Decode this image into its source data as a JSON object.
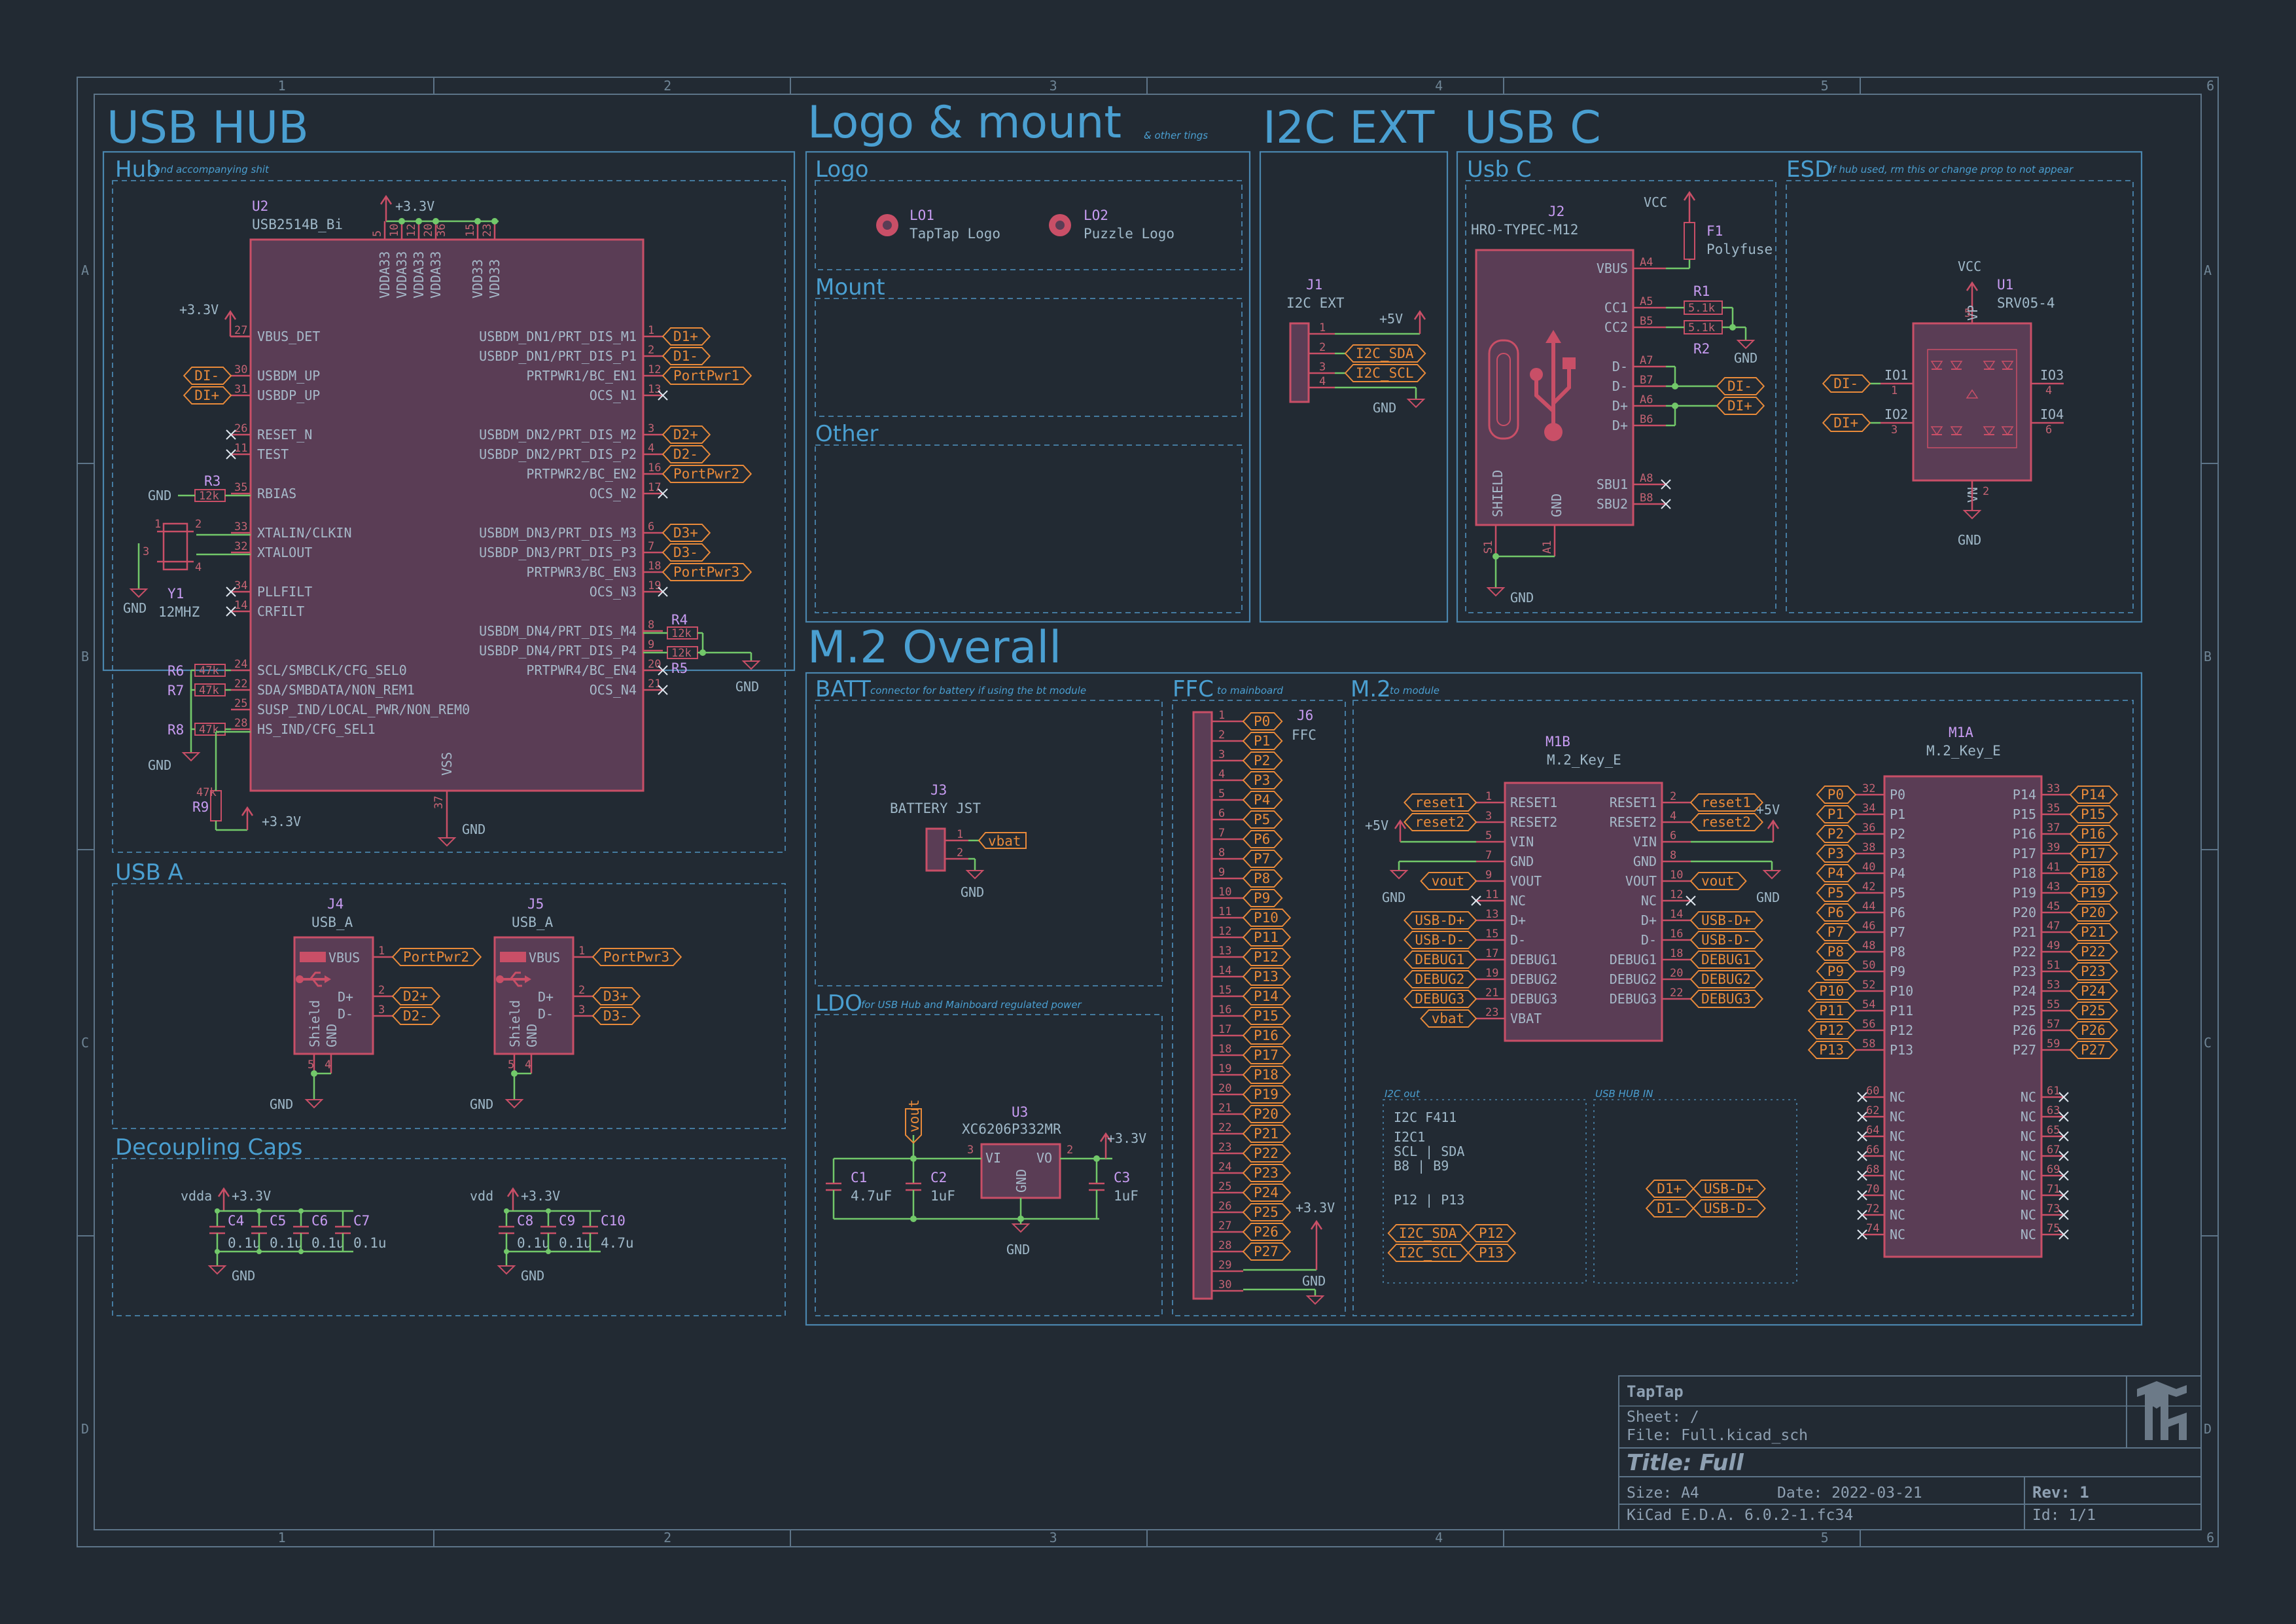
{
  "sheet_titles": {
    "usb_hub": "USB HUB",
    "logo_mount": "Logo & mount",
    "logo_mount_note": "& other tings",
    "i2c_ext": "I2C EXT",
    "usb_c": "USB C",
    "m2_overall": "M.2 Overall"
  },
  "sections": {
    "hub": {
      "title": "Hub",
      "note": "and accompanying shit"
    },
    "usb_a": {
      "title": "USB A"
    },
    "decoupling": {
      "title": "Decoupling Caps"
    },
    "logo": {
      "title": "Logo"
    },
    "mount": {
      "title": "Mount"
    },
    "other": {
      "title": "Other"
    },
    "usbc": {
      "title": "Usb C"
    },
    "esd": {
      "title": "ESD",
      "note": "If hub used, rm this or change prop to not appear"
    },
    "batt": {
      "title": "BATT",
      "note": "connector for battery if using the bt module"
    },
    "ldo": {
      "title": "LDO",
      "note": "for USB Hub and Mainboard regulated power"
    },
    "ffc": {
      "title": "FFC",
      "note": "to mainboard"
    },
    "m2": {
      "title": "M.2",
      "note": "to module"
    },
    "i2c_out": {
      "title": "I2C out"
    },
    "usb_hub_in": {
      "title": "USB HUB IN"
    }
  },
  "u2": {
    "ref": "U2",
    "value": "USB2514B_Bi",
    "top_pins": [
      "VDDA33",
      "VDDA33",
      "VDDA33",
      "VDDA33",
      "VDD33",
      "VDD33"
    ],
    "top_nums": [
      "5",
      "10",
      "12",
      "20",
      "36",
      "15",
      "23"
    ],
    "left": [
      {
        "n": "27",
        "t": "VBUS_DET"
      },
      {
        "n": "30",
        "t": "USBDM_UP"
      },
      {
        "n": "31",
        "t": "USBDP_UP"
      },
      {
        "n": "26",
        "t": "RESET_N"
      },
      {
        "n": "11",
        "t": "TEST"
      },
      {
        "n": "35",
        "t": "RBIAS"
      },
      {
        "n": "33",
        "t": "XTALIN/CLKIN"
      },
      {
        "n": "32",
        "t": "XTALOUT"
      },
      {
        "n": "34",
        "t": "PLLFILT"
      },
      {
        "n": "14",
        "t": "CRFILT"
      },
      {
        "n": "24",
        "t": "SCL/SMBCLK/CFG_SEL0"
      },
      {
        "n": "22",
        "t": "SDA/SMBDATA/NON_REM1"
      },
      {
        "n": "25",
        "t": "SUSP_IND/LOCAL_PWR/NON_REM0"
      },
      {
        "n": "28",
        "t": "HS_IND/CFG_SEL1"
      }
    ],
    "right": [
      {
        "n": "1",
        "t": "USBDM_DN1/PRT_DIS_M1"
      },
      {
        "n": "2",
        "t": "USBDP_DN1/PRT_DIS_P1"
      },
      {
        "n": "12",
        "t": "PRTPWR1/BC_EN1"
      },
      {
        "n": "13",
        "t": "OCS_N1"
      },
      {
        "n": "3",
        "t": "USBDM_DN2/PRT_DIS_M2"
      },
      {
        "n": "4",
        "t": "USBDP_DN2/PRT_DIS_P2"
      },
      {
        "n": "16",
        "t": "PRTPWR2/BC_EN2"
      },
      {
        "n": "17",
        "t": "OCS_N2"
      },
      {
        "n": "6",
        "t": "USBDM_DN3/PRT_DIS_M3"
      },
      {
        "n": "7",
        "t": "USBDP_DN3/PRT_DIS_P3"
      },
      {
        "n": "18",
        "t": "PRTPWR3/BC_EN3"
      },
      {
        "n": "19",
        "t": "OCS_N3"
      },
      {
        "n": "8",
        "t": "USBDM_DN4/PRT_DIS_M4"
      },
      {
        "n": "9",
        "t": "USBDP_DN4/PRT_DIS_P4"
      },
      {
        "n": "20",
        "t": "PRTPWR4/BC_EN4"
      },
      {
        "n": "21",
        "t": "OCS_N4"
      }
    ],
    "vss": "VSS",
    "vss_num": "37",
    "right_labels": [
      "D1+",
      "D1-",
      "PortPwr1",
      "D2+",
      "D2-",
      "PortPwr2",
      "D3+",
      "D3-",
      "PortPwr3"
    ],
    "left_labels": [
      "DI-",
      "DI+"
    ]
  },
  "hub_parts": {
    "r3": "R3",
    "r3v": "12k",
    "y1": "Y1",
    "y1v": "12MHZ",
    "r4": "R4",
    "r5": "R5",
    "r45v": "12k",
    "r6": "R6",
    "r7": "R7",
    "r8": "R8",
    "r9": "R9",
    "rv": "47k",
    "y1pins": [
      "1",
      "2",
      "3",
      "4"
    ]
  },
  "power": {
    "p33": "+3.3V",
    "gnd": "GND",
    "vcc": "VCC",
    "p5": "+5V",
    "vdda": "vdda",
    "vdd": "vdd"
  },
  "usb_a": [
    {
      "ref": "J4",
      "value": "USB_A",
      "pins": [
        "VBUS",
        "D+",
        "D-",
        "Shield",
        "GND"
      ],
      "labels": [
        "PortPwr2",
        "D2+",
        "D2-"
      ]
    },
    {
      "ref": "J5",
      "value": "USB_A",
      "pins": [
        "VBUS",
        "D+",
        "D-",
        "Shield",
        "GND"
      ],
      "labels": [
        "PortPwr3",
        "D3+",
        "D3-"
      ]
    }
  ],
  "caps_a": [
    {
      "ref": "C4",
      "v": "0.1u"
    },
    {
      "ref": "C5",
      "v": "0.1u"
    },
    {
      "ref": "C6",
      "v": "0.1u"
    },
    {
      "ref": "C7",
      "v": "0.1u"
    }
  ],
  "caps_b": [
    {
      "ref": "C8",
      "v": "0.1u"
    },
    {
      "ref": "C9",
      "v": "0.1u"
    },
    {
      "ref": "C10",
      "v": "4.7u"
    }
  ],
  "logos": [
    {
      "ref": "LO1",
      "v": "TapTap Logo"
    },
    {
      "ref": "LO2",
      "v": "Puzzle Logo"
    }
  ],
  "j1": {
    "ref": "J1",
    "value": "I2C EXT",
    "pins": [
      "1",
      "2",
      "3",
      "4"
    ],
    "labels": [
      "I2C_SDA",
      "I2C_SCL"
    ]
  },
  "j2": {
    "ref": "J2",
    "value": "HRO-TYPEC-M12",
    "pins": [
      "VBUS",
      "CC1",
      "CC2",
      "D-",
      "D-",
      "D+",
      "D+",
      "SBU1",
      "SBU2"
    ],
    "nums": [
      "A4",
      "A5",
      "B5",
      "A7",
      "B7",
      "A6",
      "B6",
      "A8",
      "B8"
    ],
    "bottom": [
      "SHIELD",
      "GND"
    ],
    "bottom_nums": [
      "S1",
      "A1"
    ],
    "labels": [
      "DI-",
      "DI+"
    ]
  },
  "f1": {
    "ref": "F1",
    "value": "Polyfuse"
  },
  "r1r2": {
    "r1": "R1",
    "r2": "R2",
    "v": "5.1k"
  },
  "u1": {
    "ref": "U1",
    "value": "SRV05-4",
    "pins": [
      "IO1",
      "IO2",
      "IO3",
      "IO4",
      "VP",
      "VN"
    ],
    "nums": [
      "1",
      "3",
      "4",
      "6",
      "5",
      "2"
    ],
    "labels": [
      "DI-",
      "DI+"
    ]
  },
  "j3": {
    "ref": "J3",
    "value": "BATTERY JST",
    "pins": [
      "1",
      "2"
    ],
    "label": "vbat"
  },
  "u3": {
    "ref": "U3",
    "value": "XC6206P332MR",
    "pins": [
      "VI",
      "VO",
      "GND"
    ],
    "nums": [
      "3",
      "2",
      "1"
    ],
    "label": "vout"
  },
  "ldo_caps": [
    {
      "ref": "C1",
      "v": "4.7uF"
    },
    {
      "ref": "C2",
      "v": "1uF"
    },
    {
      "ref": "C3",
      "v": "1uF"
    }
  ],
  "j6": {
    "ref": "J6",
    "value": "FFC",
    "labels": [
      "P0",
      "P1",
      "P2",
      "P3",
      "P4",
      "P5",
      "P6",
      "P7",
      "P8",
      "P9",
      "P10",
      "P11",
      "P12",
      "P13",
      "P14",
      "P15",
      "P16",
      "P17",
      "P18",
      "P19",
      "P20",
      "P21",
      "P22",
      "P23",
      "P24",
      "P25",
      "P26",
      "P27"
    ]
  },
  "m1b": {
    "ref": "M1B",
    "value": "M.2_Key_E",
    "left": [
      {
        "n": "1",
        "t": "RESET1",
        "l": "reset1"
      },
      {
        "n": "3",
        "t": "RESET2",
        "l": "reset2"
      },
      {
        "n": "5",
        "t": "VIN",
        "l": ""
      },
      {
        "n": "7",
        "t": "GND",
        "l": ""
      },
      {
        "n": "9",
        "t": "VOUT",
        "l": "vout"
      },
      {
        "n": "11",
        "t": "NC",
        "l": ""
      },
      {
        "n": "13",
        "t": "D+",
        "l": "USB-D+"
      },
      {
        "n": "15",
        "t": "D-",
        "l": "USB-D-"
      },
      {
        "n": "17",
        "t": "DEBUG1",
        "l": "DEBUG1"
      },
      {
        "n": "19",
        "t": "DEBUG2",
        "l": "DEBUG2"
      },
      {
        "n": "21",
        "t": "DEBUG3",
        "l": "DEBUG3"
      },
      {
        "n": "23",
        "t": "VBAT",
        "l": "vbat"
      }
    ],
    "right": [
      {
        "n": "2",
        "t": "RESET1",
        "l": "reset1"
      },
      {
        "n": "4",
        "t": "RESET2",
        "l": "reset2"
      },
      {
        "n": "6",
        "t": "VIN",
        "l": ""
      },
      {
        "n": "8",
        "t": "GND",
        "l": ""
      },
      {
        "n": "10",
        "t": "VOUT",
        "l": "vout"
      },
      {
        "n": "12",
        "t": "NC",
        "l": ""
      },
      {
        "n": "14",
        "t": "D+",
        "l": "USB-D+"
      },
      {
        "n": "16",
        "t": "D-",
        "l": "USB-D-"
      },
      {
        "n": "18",
        "t": "DEBUG1",
        "l": "DEBUG1"
      },
      {
        "n": "20",
        "t": "DEBUG2",
        "l": "DEBUG2"
      },
      {
        "n": "22",
        "t": "DEBUG3",
        "l": "DEBUG3"
      }
    ]
  },
  "m1a": {
    "ref": "M1A",
    "value": "M.2_Key_E",
    "left": [
      {
        "n": "32",
        "t": "P0"
      },
      {
        "n": "34",
        "t": "P1"
      },
      {
        "n": "36",
        "t": "P2"
      },
      {
        "n": "38",
        "t": "P3"
      },
      {
        "n": "40",
        "t": "P4"
      },
      {
        "n": "42",
        "t": "P5"
      },
      {
        "n": "44",
        "t": "P6"
      },
      {
        "n": "46",
        "t": "P7"
      },
      {
        "n": "48",
        "t": "P8"
      },
      {
        "n": "50",
        "t": "P9"
      },
      {
        "n": "52",
        "t": "P10"
      },
      {
        "n": "54",
        "t": "P11"
      },
      {
        "n": "56",
        "t": "P12"
      },
      {
        "n": "58",
        "t": "P13"
      }
    ],
    "right": [
      {
        "n": "33",
        "t": "P14"
      },
      {
        "n": "35",
        "t": "P15"
      },
      {
        "n": "37",
        "t": "P16"
      },
      {
        "n": "39",
        "t": "P17"
      },
      {
        "n": "41",
        "t": "P18"
      },
      {
        "n": "43",
        "t": "P19"
      },
      {
        "n": "45",
        "t": "P20"
      },
      {
        "n": "47",
        "t": "P21"
      },
      {
        "n": "49",
        "t": "P22"
      },
      {
        "n": "51",
        "t": "P23"
      },
      {
        "n": "53",
        "t": "P24"
      },
      {
        "n": "55",
        "t": "P25"
      },
      {
        "n": "57",
        "t": "P26"
      },
      {
        "n": "59",
        "t": "P27"
      }
    ],
    "nc_left": [
      "60",
      "62",
      "64",
      "66",
      "68",
      "70",
      "72",
      "74"
    ],
    "nc_right": [
      "61",
      "63",
      "65",
      "67",
      "69",
      "71",
      "73",
      "75"
    ],
    "nc": "NC"
  },
  "i2c_out": {
    "lines": [
      "I2C F411",
      "I2C1",
      "SCL | SDA",
      "B8  | B9",
      "P12 | P13"
    ],
    "labels": [
      "I2C_SDA",
      "I2C_SCL",
      "P12",
      "P13"
    ]
  },
  "usb_hub_in": {
    "labels": [
      "D1+",
      "D1-",
      "USB-D+",
      "USB-D-"
    ]
  },
  "title_block": {
    "company": "TapTap",
    "sheet": "Sheet: /",
    "file": "File: Full.kicad_sch",
    "title": "Title: Full",
    "size": "Size: A4",
    "date": "Date: 2022-03-21",
    "rev": "Rev: 1",
    "tool": "KiCad E.D.A.  6.0.2-1.fc34",
    "id": "Id: 1/1"
  },
  "frame": {
    "cols": [
      "1",
      "2",
      "3",
      "4",
      "5",
      "6"
    ],
    "rows": [
      "A",
      "B",
      "C",
      "D"
    ]
  }
}
